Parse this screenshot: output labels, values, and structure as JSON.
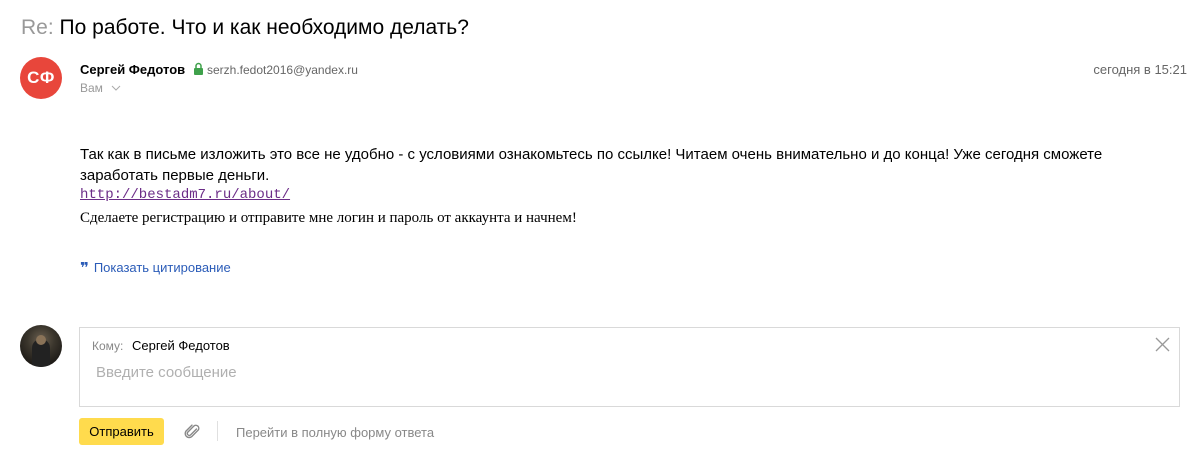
{
  "message": {
    "subject_prefix": "Re:",
    "subject": "По работе. Что и как необходимо делать?",
    "sender": {
      "initials": "СФ",
      "name": "Сергей Федотов",
      "email": "serzh.fedot2016@yandex.ru",
      "avatar_color": "#e8463b"
    },
    "date": "сегодня в 15:21",
    "recipient": "Вам",
    "body": {
      "paragraph": "Так как в письме изложить это все не удобно -  с условиями ознакомьтесь по ссылке! Читаем очень внимательно и до конца! Уже сегодня сможете заработать первые деньги.",
      "link": "http://bestadm7.ru/about/",
      "paragraph2": "Сделаете регистрацию и отправите мне логин и пароль от аккаунта и начнем!"
    },
    "show_quote": "Показать цитирование"
  },
  "reply": {
    "to_label": "Кому:",
    "to_value": "Сергей Федотов",
    "placeholder": "Введите сообщение",
    "send_label": "Отправить",
    "full_form_link": "Перейти в полную форму ответа"
  },
  "colors": {
    "send_button": "#ffdb4d",
    "link": "#6b2c87",
    "quote_link": "#2b5cb8"
  },
  "icons": [
    "lock-icon",
    "chevron-down-icon",
    "quote-icon",
    "close-icon",
    "attach-icon"
  ]
}
